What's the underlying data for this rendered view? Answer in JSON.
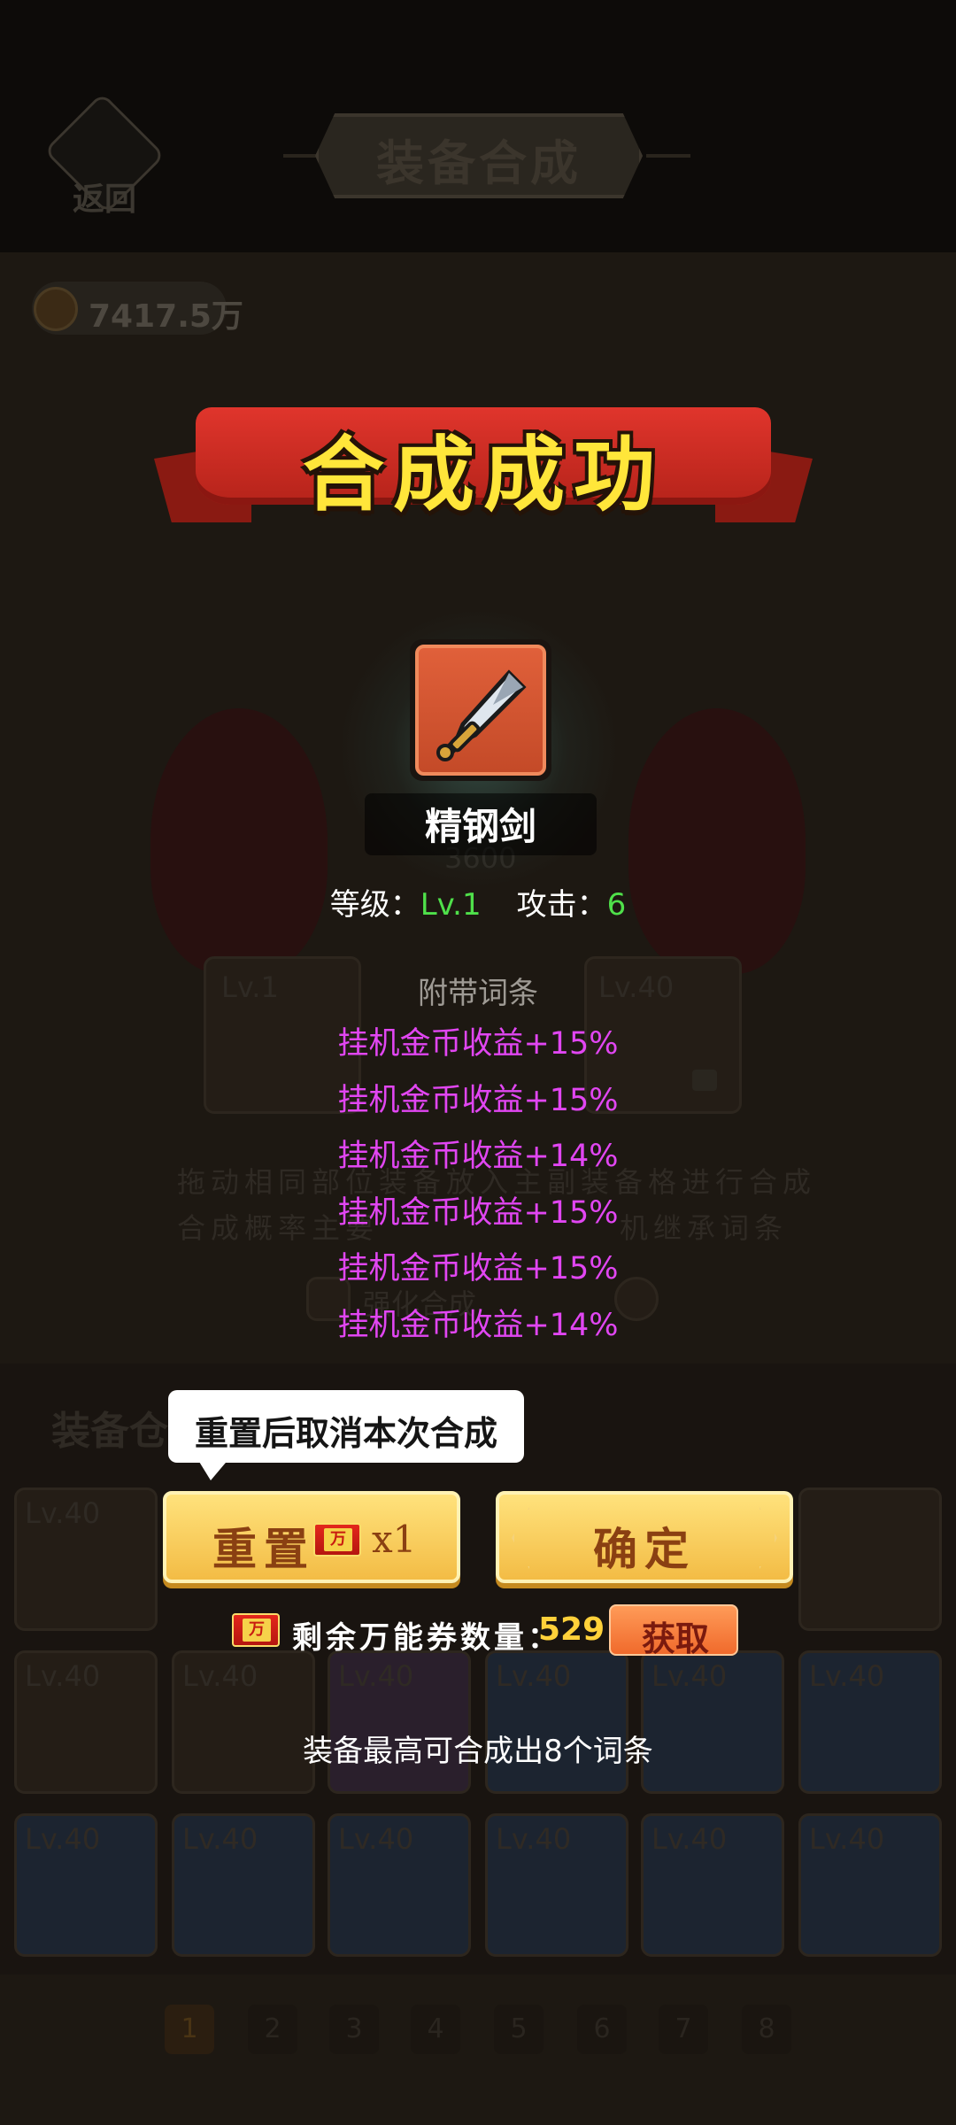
{
  "header": {
    "back_label": "返回",
    "title": "装备合成"
  },
  "currency": {
    "gold": "7417.5万"
  },
  "background_texts": {
    "level_main": "Lv.1",
    "level_sub": "Lv.40",
    "power": "3600",
    "rules_line1": "拖动相同部位装备放入主副装备格进行合成",
    "rules_line2": "合成概率主要",
    "rules_line2b": "机继承词条",
    "toggle_label": "强化合成",
    "inventory_title": "装备仓",
    "slot_level": "Lv.40"
  },
  "popup": {
    "banner_title": "合成成功",
    "item": {
      "name": "精钢剑"
    },
    "stats": {
      "level_label": "等级：",
      "level_value": "Lv.1",
      "attack_label": "攻击：",
      "attack_value": "6"
    },
    "affix_title": "附带词条",
    "affixes": [
      "挂机金币收益+15%",
      "挂机金币收益+15%",
      "挂机金币收益+14%",
      "挂机金币收益+15%",
      "挂机金币收益+15%",
      "挂机金币收益+14%"
    ],
    "tooltip": "重置后取消本次合成",
    "reset_button": {
      "label": "重置",
      "ticket_text": "万",
      "count": "x1"
    },
    "confirm_button": {
      "label": "确定"
    },
    "remaining": {
      "label": "剩余万能券数量：",
      "value": "529",
      "get_label": "获取"
    },
    "hint": "装备最高可合成出8个词条"
  },
  "pagination": [
    "1",
    "2",
    "3",
    "4",
    "5",
    "6",
    "7",
    "8"
  ],
  "colors": {
    "banner_red": "#d12c22",
    "title_yellow": "#ffe63a",
    "level_green": "#4fe04a",
    "affix_purple": "#e146f2",
    "button_gold": "#f8d063",
    "get_orange": "#f47a3a"
  }
}
